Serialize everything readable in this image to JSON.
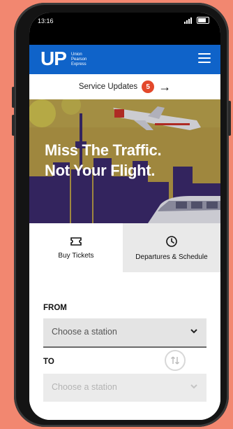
{
  "status_bar": {
    "time": "13:16"
  },
  "header": {
    "logo": "UP",
    "logo_sub_line1": "Union",
    "logo_sub_line2": "Pearson",
    "logo_sub_line3": "Express"
  },
  "service_updates": {
    "label": "Service Updates",
    "count": "5"
  },
  "hero": {
    "line1": "Miss The Traffic.",
    "line2": "Not Your Flight."
  },
  "tabs": [
    {
      "label": "Buy Tickets",
      "icon": "ticket-icon"
    },
    {
      "label": "Departures & Schedule",
      "icon": "clock-icon"
    }
  ],
  "form": {
    "from_label": "FROM",
    "from_placeholder": "Choose a station",
    "to_label": "TO",
    "to_placeholder": "Choose a station"
  },
  "colors": {
    "background": "#f28770",
    "brand_blue": "#0f63c9",
    "badge": "#e3482b",
    "hero_gold": "#b59a47",
    "hero_skyline": "#3b2a6b"
  }
}
